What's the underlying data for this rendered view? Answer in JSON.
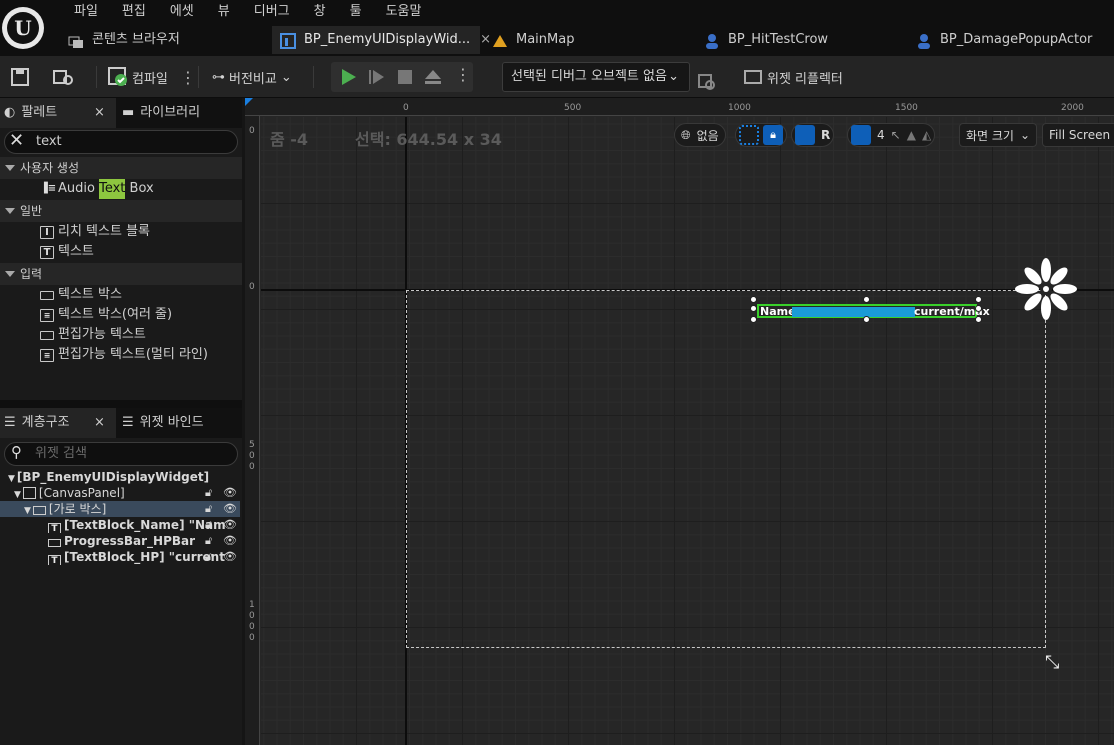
{
  "menu": [
    "파일",
    "편집",
    "에셋",
    "뷰",
    "디버그",
    "창",
    "툴",
    "도움말"
  ],
  "tabs": [
    {
      "label": "콘텐츠 브라우저",
      "icon": "folder-icon"
    },
    {
      "label": "BP_EnemyUIDisplayWid...",
      "icon": "widget-blueprint-icon",
      "close": "×"
    },
    {
      "label": "MainMap",
      "icon": "map-icon"
    },
    {
      "label": "BP_HitTestCrow",
      "icon": "actor-icon"
    },
    {
      "label": "BP_DamagePopupActor",
      "icon": "actor-icon"
    }
  ],
  "toolbar": {
    "compile_label": "컴파일",
    "diff_label": "버전비교",
    "debug_object": "선택된 디버그 오브젝트 없음",
    "reflector_label": "위젯 리플렉터"
  },
  "palette": {
    "tab_label": "팔레트",
    "library_label": "라이브러리",
    "search_value": "text",
    "categories": [
      {
        "label": "사용자 생성",
        "items": [
          {
            "pre": "Audio ",
            "hl": "Text",
            "post": " Box"
          }
        ]
      },
      {
        "label": "일반",
        "items": [
          {
            "label": "리치 텍스트 블록"
          },
          {
            "label": "텍스트"
          }
        ]
      },
      {
        "label": "입력",
        "items": [
          {
            "label": "텍스트 박스"
          },
          {
            "label": "텍스트 박스(여러 줄)"
          },
          {
            "label": "편집가능 텍스트"
          },
          {
            "label": "편집가능 텍스트(멀티 라인)"
          }
        ]
      }
    ]
  },
  "hierarchy": {
    "tab_label": "계층구조",
    "bind_label": "위젯 바인드",
    "search_placeholder": "위젯 검색",
    "rows": [
      "[BP_EnemyUIDisplayWidget]",
      "[CanvasPanel]",
      "[가로 박스]",
      "[TextBlock_Name] \"Nam",
      "ProgressBar_HPBar",
      "[TextBlock_HP] \"current"
    ]
  },
  "designer": {
    "zoom_label": "줌 -4",
    "selection_label": "선택: 644.54 x 34",
    "ruler_top": [
      "0",
      "500",
      "1000",
      "1500",
      "2000"
    ],
    "ruler_left": [
      "0",
      "0",
      "5 0 0",
      "1 0 0 0"
    ],
    "localize_label": "없음",
    "grid_value": "4",
    "r_label": "R",
    "screen_size_label": "화면 크기",
    "fill_label": "Fill Screen"
  },
  "widget": {
    "name": "Name",
    "hp": "current/max",
    "hp_percent": 100
  }
}
